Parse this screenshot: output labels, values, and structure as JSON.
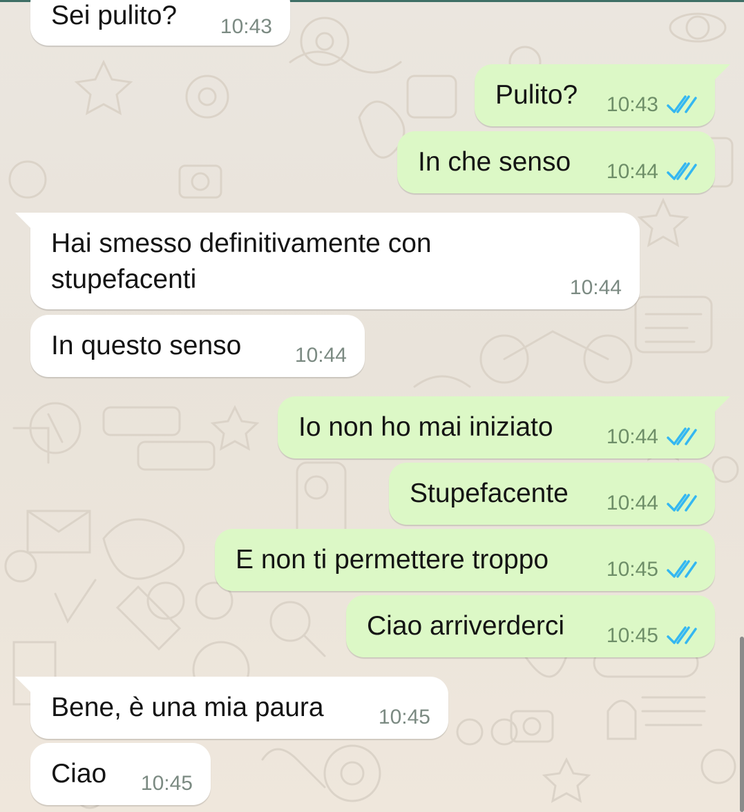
{
  "colors": {
    "incoming_bubble": "#ffffff",
    "outgoing_bubble": "#dcf8c6",
    "read_ticks": "#34b7f1",
    "background": "#ece5dd"
  },
  "icons": {
    "read_receipt": "double-check-icon"
  },
  "messages": [
    {
      "direction": "incoming",
      "text": "Sei pulito?",
      "time": "10:43"
    },
    {
      "direction": "outgoing",
      "text": "Pulito?",
      "time": "10:43",
      "status": "read"
    },
    {
      "direction": "outgoing",
      "text": "In che senso",
      "time": "10:44",
      "status": "read"
    },
    {
      "direction": "incoming",
      "text_lines": [
        "Hai smesso definitivamente con",
        "stupefacenti"
      ],
      "time": "10:44"
    },
    {
      "direction": "incoming",
      "text": "In questo senso",
      "time": "10:44"
    },
    {
      "direction": "outgoing",
      "text": "Io non ho mai iniziato",
      "time": "10:44",
      "status": "read"
    },
    {
      "direction": "outgoing",
      "text": "Stupefacente",
      "time": "10:44",
      "status": "read"
    },
    {
      "direction": "outgoing",
      "text": "E non ti permettere troppo",
      "time": "10:45",
      "status": "read"
    },
    {
      "direction": "outgoing",
      "text": "Ciao arriverderci",
      "time": "10:45",
      "status": "read"
    },
    {
      "direction": "incoming",
      "text": "Bene, è una mia paura",
      "time": "10:45"
    },
    {
      "direction": "incoming",
      "text": "Ciao",
      "time": "10:45"
    }
  ]
}
